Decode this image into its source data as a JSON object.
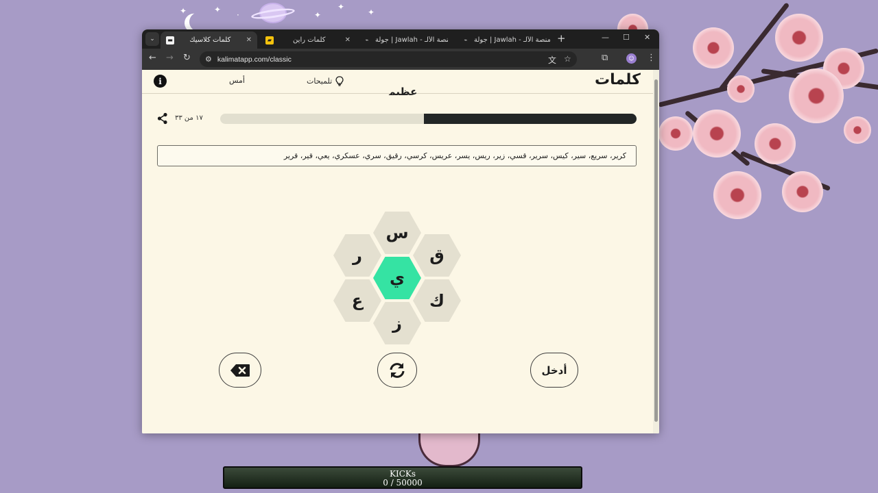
{
  "browser": {
    "tabs": [
      {
        "title": "كلمات كلاسيك",
        "favicon": "kalimat-favicon",
        "active": true
      },
      {
        "title": "كلمات راين",
        "favicon": "kalimat-rain-favicon",
        "active": false
      },
      {
        "title": "جولة | Jawlah - منصة الألـ",
        "favicon": "jawlah-favicon",
        "active": false
      },
      {
        "title": "جولة | Jawlah - منصة الألـ",
        "favicon": "jawlah-favicon",
        "active": false
      }
    ],
    "url": "kalimatapp.com/classic"
  },
  "header": {
    "logo": "كلمات",
    "hints_label": "تلميحات",
    "yesterday_label": "أمس"
  },
  "game": {
    "rank": "عظيم",
    "score_text": "١٧ من ٣٣",
    "progress": 0.51,
    "found_words": "كرير، سريع، سير، كيس، سرير، قسي، زير، ريس، يسر، عريس، كرسي، رقيق، سري، عسكري، يعي، قير، قرير",
    "letters": {
      "center": "ي",
      "top": "س",
      "upper_right": "ق",
      "upper_left": "ر",
      "lower_right": "ك",
      "lower_left": "ع",
      "bottom": "ز"
    },
    "enter_label": "أدخل"
  },
  "counter": {
    "label": "KICKs",
    "value": "0 / 50000"
  },
  "colors": {
    "background": "#a79bc6",
    "page": "#fcf7e6",
    "center_hex": "#35e3a3",
    "outer_hex": "#e4e0d0",
    "progress": "#222626"
  }
}
